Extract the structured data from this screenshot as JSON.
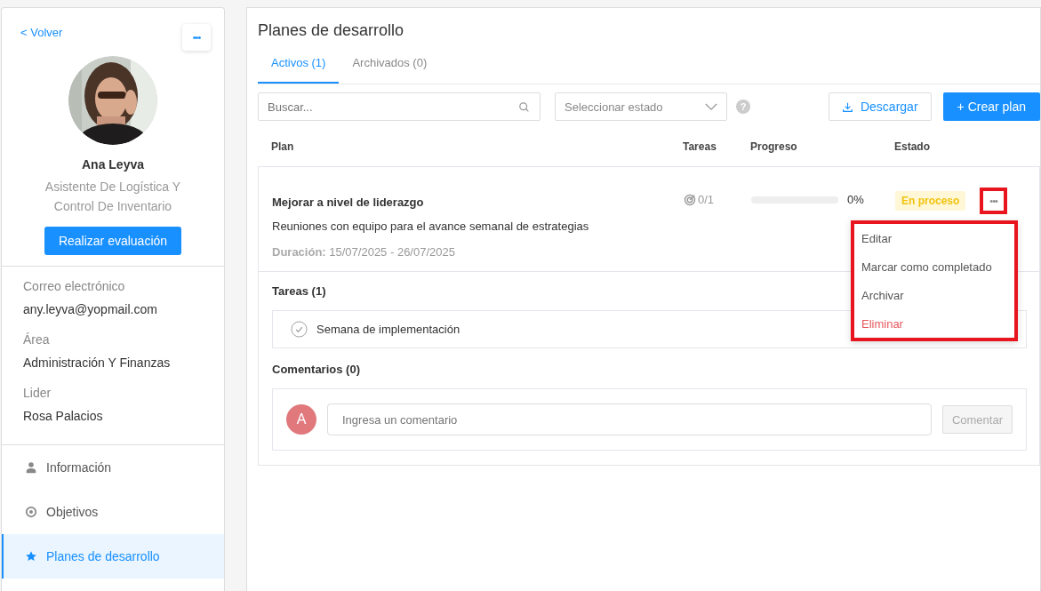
{
  "sidebar": {
    "back_link": "< Volver",
    "more_button": "•••",
    "profile": {
      "name": "Ana Leyva",
      "role": "Asistente De Logística Y Control De Inventario",
      "action": "Realizar evaluación"
    },
    "fields": [
      {
        "label": "Correo electrónico",
        "value": "any.leyva@yopmail.com"
      },
      {
        "label": "Área",
        "value": "Administración Y Finanzas"
      },
      {
        "label": "Lider",
        "value": "Rosa Palacios"
      }
    ],
    "nav": [
      {
        "label": "Información",
        "selected": false
      },
      {
        "label": "Objetivos",
        "selected": false
      },
      {
        "label": "Planes de desarrollo",
        "selected": true
      }
    ]
  },
  "main": {
    "title": "Planes de desarrollo",
    "tabs": [
      {
        "label": "Activos (1)",
        "selected": true
      },
      {
        "label": "Archivados (0)",
        "selected": false
      }
    ],
    "search": {
      "placeholder": "Buscar..."
    },
    "status_select": {
      "placeholder": "Seleccionar estado"
    },
    "help": "?",
    "download_button": "Descargar",
    "create_button": "+ Crear plan",
    "columns": [
      "Plan",
      "Tareas",
      "Progreso",
      "Estado"
    ],
    "plan": {
      "title": "Mejorar a nivel de liderazgo",
      "description": "Reuniones con equipo para el avance semanal de estrategias",
      "duration_label": "Duración:",
      "duration": "15/07/2025 - 26/07/2025",
      "tasks": "0/1",
      "level": 0,
      "progress": "0%",
      "status": "En proceso",
      "menu_button": "•••",
      "menu_highlighted": true,
      "menu": [
        {
          "label": "Editar",
          "kind": "normal"
        },
        {
          "label": "Marcar como completado",
          "kind": "normal"
        },
        {
          "label": "Archivar",
          "kind": "normal"
        },
        {
          "label": "Eliminar",
          "kind": "danger"
        }
      ],
      "tasks_title": "Tareas (1)",
      "task_items": [
        {
          "name": "Semana de implementación",
          "done": false
        }
      ],
      "comments_title": "Comentarios (0)",
      "comment": {
        "avatar": "A",
        "placeholder": "Ingresa un comentario",
        "button": "Comentar",
        "disabled": true
      }
    }
  }
}
